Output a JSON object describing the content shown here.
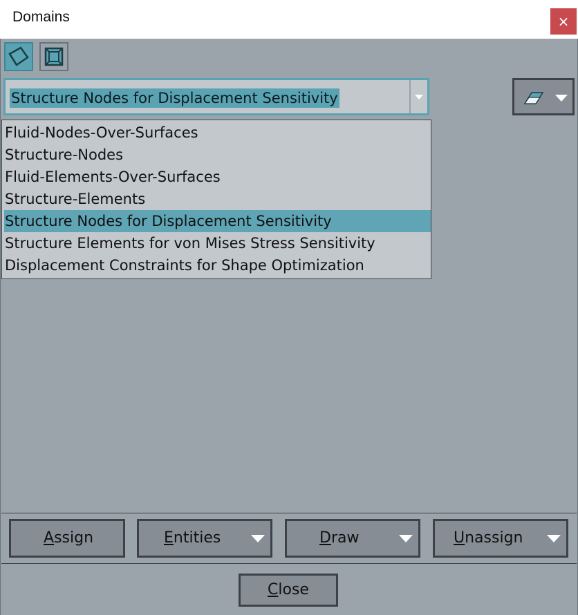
{
  "window": {
    "title": "Domains",
    "close_glyph": "×"
  },
  "toolbar": {
    "icons": [
      {
        "name": "surface-domain-icon",
        "active": true
      },
      {
        "name": "volume-domain-icon",
        "active": false
      }
    ]
  },
  "domain_select": {
    "value": "Structure Nodes for Displacement Sensitivity"
  },
  "visibility_button": {
    "icon": "eraser-display-icon"
  },
  "domain_list": {
    "items": [
      "Fluid-Nodes-Over-Surfaces",
      "Structure-Nodes",
      "Fluid-Elements-Over-Surfaces",
      "Structure-Elements",
      "Structure Nodes for Displacement Sensitivity",
      "Structure Elements for von Mises Stress Sensitivity",
      "Displacement Constraints for Shape Optimization"
    ],
    "selected_index": 4
  },
  "actions": {
    "assign": {
      "first": "A",
      "rest": "ssign"
    },
    "entities": {
      "first": "E",
      "rest": "ntities"
    },
    "draw": {
      "first": "D",
      "rest": "raw"
    },
    "unassign": {
      "first": "U",
      "rest": "nassign"
    }
  },
  "footer": {
    "close": {
      "first": "C",
      "rest": "lose"
    }
  },
  "colors": {
    "accent": "#5aa3b3",
    "background": "#9ba3ab",
    "list_bg": "#c3c8cd",
    "close_red": "#c74a4f"
  }
}
